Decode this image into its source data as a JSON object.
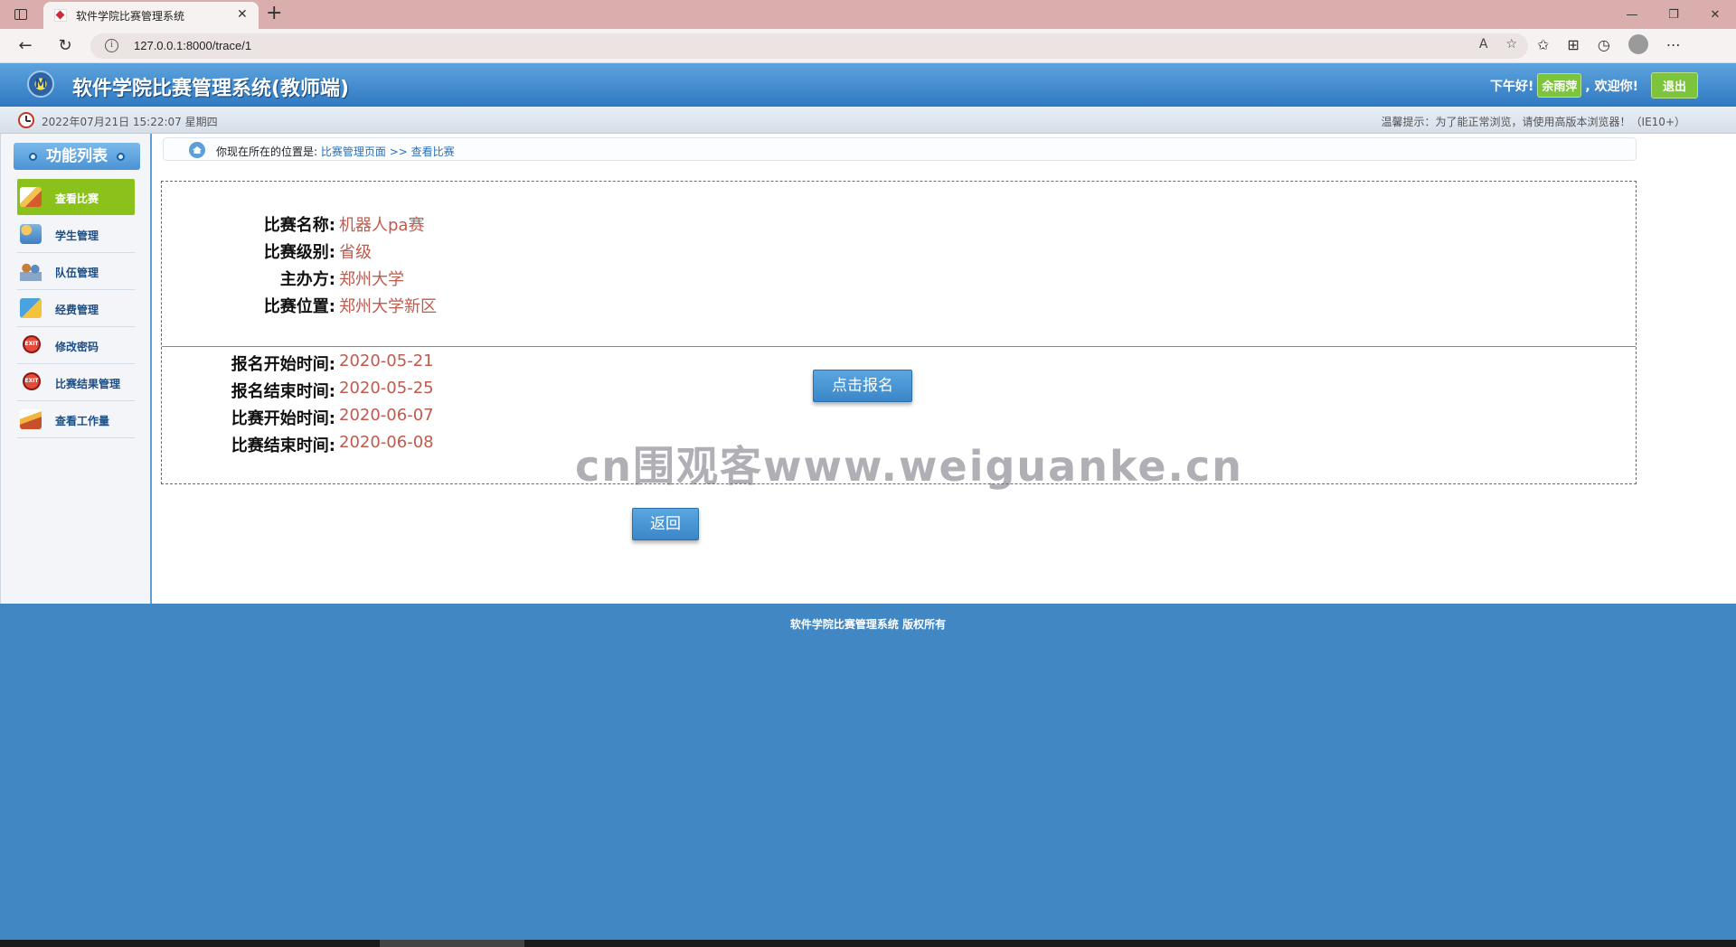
{
  "browser": {
    "tab_title": "软件学院比赛管理系统",
    "url": "127.0.0.1:8000/trace/1"
  },
  "header": {
    "title": "软件学院比赛管理系统(教师端)",
    "greeting": "下午好!",
    "username": "余雨萍",
    "welcome": ", 欢迎你!",
    "logout_label": "退出"
  },
  "info_strip": {
    "datetime": "2022年07月21日 15:22:07 星期四",
    "tip": "温馨提示：为了能正常浏览，请使用高版本浏览器！（IE10+）"
  },
  "sidebar": {
    "title": "功能列表",
    "items": [
      {
        "label": "查看比赛",
        "icon": "book-icon",
        "active": true
      },
      {
        "label": "学生管理",
        "icon": "student-icon",
        "active": false
      },
      {
        "label": "队伍管理",
        "icon": "team-icon",
        "active": false
      },
      {
        "label": "经费管理",
        "icon": "money-icon",
        "active": false
      },
      {
        "label": "修改密码",
        "icon": "exit-icon",
        "active": false
      },
      {
        "label": "比赛结果管理",
        "icon": "exit-icon",
        "active": false
      },
      {
        "label": "查看工作量",
        "icon": "workload-icon",
        "active": false
      }
    ],
    "exit_icon_text": "EXIT"
  },
  "breadcrumb": {
    "prefix": "你现在所在的位置是:",
    "path": "比赛管理页面 >> 查看比赛"
  },
  "competition": {
    "name_label": "比赛名称:",
    "name": "机器人pa赛",
    "level_label": "比赛级别:",
    "level": "省级",
    "organizer_label": "主办方:",
    "organizer": "郑州大学",
    "location_label": "比赛位置:",
    "location": "郑州大学新区",
    "signup_start_label": "报名开始时间:",
    "signup_start": "2020-05-21",
    "signup_end_label": "报名结束时间:",
    "signup_end": "2020-05-25",
    "start_label": "比赛开始时间:",
    "start": "2020-06-07",
    "end_label": "比赛结束时间:",
    "end": "2020-06-08"
  },
  "actions": {
    "signup_label": "点击报名",
    "back_label": "返回"
  },
  "watermark": "cn围观客www.weiguanke.cn",
  "footer": {
    "text": "软件学院比赛管理系统 版权所有"
  },
  "colors": {
    "header_blue": "#3c86cc",
    "active_green": "#8ac21b",
    "value_red": "#c05a4c",
    "footer_blue": "#4187c4"
  }
}
